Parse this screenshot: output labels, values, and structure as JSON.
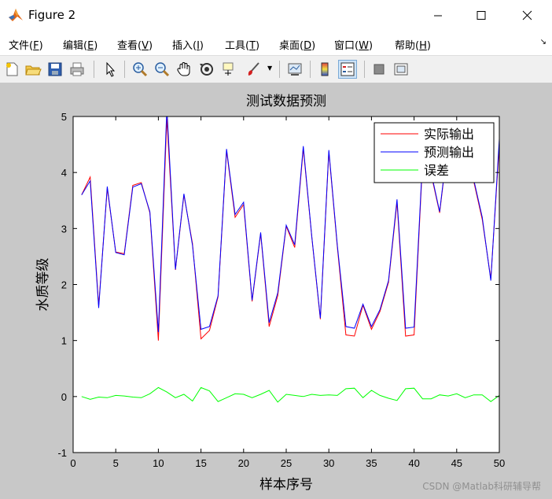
{
  "window": {
    "title": "Figure 2"
  },
  "menu": [
    {
      "label": "文件(",
      "key": "F",
      "tail": ")"
    },
    {
      "label": "编辑(",
      "key": "E",
      "tail": ")"
    },
    {
      "label": "查看(",
      "key": "V",
      "tail": ")"
    },
    {
      "label": "插入(",
      "key": "I",
      "tail": ")"
    },
    {
      "label": "工具(",
      "key": "T",
      "tail": ")"
    },
    {
      "label": "桌面(",
      "key": "D",
      "tail": ")"
    },
    {
      "label": "窗口(",
      "key": "W",
      "tail": ")"
    },
    {
      "label": "帮助(",
      "key": "H",
      "tail": ")"
    }
  ],
  "toolbar_icons": [
    "new-figure-icon",
    "open-file-icon",
    "save-icon",
    "print-icon",
    "pointer-icon",
    "zoom-in-icon",
    "zoom-out-icon",
    "pan-hand-icon",
    "rotate-3d-icon",
    "data-cursor-icon",
    "brush-icon",
    "link-plot-icon",
    "colorbar-icon",
    "legend-icon",
    "hide-plot-tools-icon",
    "show-plot-tools-icon"
  ],
  "watermark": "CSDN @Matlab科研辅导帮",
  "chart_data": {
    "type": "line",
    "title": "测试数据预测",
    "xlabel": "样本序号",
    "ylabel": "水质等级",
    "xlim": [
      0,
      50
    ],
    "ylim": [
      -1,
      5
    ],
    "xticks": [
      0,
      5,
      10,
      15,
      20,
      25,
      30,
      35,
      40,
      45,
      50
    ],
    "yticks": [
      -1,
      0,
      1,
      2,
      3,
      4,
      5
    ],
    "grid": false,
    "legend_position": "top-right",
    "x": [
      1,
      2,
      3,
      4,
      5,
      6,
      7,
      8,
      9,
      10,
      11,
      12,
      13,
      14,
      15,
      16,
      17,
      18,
      19,
      20,
      21,
      22,
      23,
      24,
      25,
      26,
      27,
      28,
      29,
      30,
      31,
      32,
      33,
      34,
      35,
      36,
      37,
      38,
      39,
      40,
      41,
      42,
      43,
      44,
      45,
      46,
      47,
      48,
      49,
      50
    ],
    "series": [
      {
        "name": "实际输出",
        "color": "#ff0000",
        "values": [
          3.6,
          3.92,
          1.62,
          3.72,
          2.58,
          2.55,
          3.77,
          3.82,
          3.28,
          1.0,
          4.97,
          2.26,
          3.6,
          2.73,
          1.03,
          1.18,
          1.78,
          4.39,
          3.2,
          3.43,
          1.7,
          2.91,
          1.25,
          1.8,
          3.04,
          2.66,
          4.43,
          2.85,
          1.38,
          4.37,
          2.67,
          1.1,
          1.08,
          1.63,
          1.2,
          1.52,
          2.04,
          3.47,
          1.08,
          1.1,
          4.2,
          3.97,
          3.28,
          4.55,
          4.62,
          4.37,
          3.84,
          3.16,
          2.1,
          4.5
        ]
      },
      {
        "name": "预测输出",
        "color": "#0000ff",
        "values": [
          3.6,
          3.85,
          1.58,
          3.75,
          2.57,
          2.53,
          3.74,
          3.8,
          3.3,
          1.15,
          5.15,
          2.27,
          3.62,
          2.7,
          1.2,
          1.25,
          1.8,
          4.42,
          3.25,
          3.47,
          1.72,
          2.93,
          1.32,
          1.85,
          3.06,
          2.71,
          4.47,
          2.86,
          1.4,
          4.4,
          2.7,
          1.25,
          1.22,
          1.65,
          1.25,
          1.55,
          2.07,
          3.52,
          1.22,
          1.24,
          4.25,
          4.0,
          3.3,
          4.58,
          4.65,
          4.4,
          3.87,
          3.2,
          2.07,
          4.6
        ]
      },
      {
        "name": "误差",
        "color": "#00ff00",
        "values": [
          0.0,
          -0.05,
          -0.01,
          -0.02,
          0.02,
          0.01,
          -0.01,
          -0.02,
          0.05,
          0.16,
          0.08,
          -0.02,
          0.04,
          -0.08,
          0.16,
          0.1,
          -0.09,
          -0.02,
          0.05,
          0.04,
          -0.02,
          0.04,
          0.11,
          -0.1,
          0.04,
          0.02,
          0.0,
          0.04,
          0.02,
          0.03,
          0.02,
          0.14,
          0.15,
          -0.02,
          0.11,
          0.02,
          -0.03,
          -0.07,
          0.14,
          0.15,
          -0.04,
          -0.04,
          0.03,
          0.01,
          0.05,
          -0.02,
          0.03,
          0.03,
          -0.09,
          0.02
        ]
      }
    ]
  }
}
